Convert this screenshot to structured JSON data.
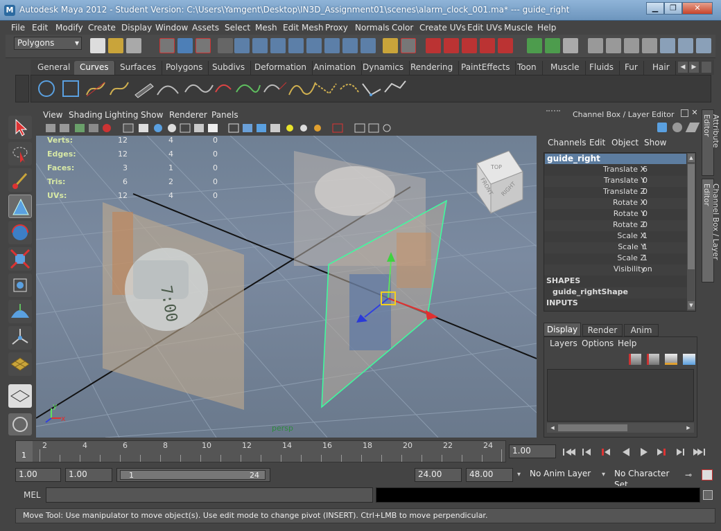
{
  "window": {
    "title": "Autodesk Maya 2012 - Student Version: C:\\Users\\Yamgent\\Desktop\\IN3D_Assignment01\\scenes\\alarm_clock_001.ma*   ---   guide_right",
    "minimize": "▁",
    "restore": "❐",
    "close": "✕"
  },
  "menubar": [
    "File",
    "Edit",
    "Modify",
    "Create",
    "Display",
    "Window",
    "Assets",
    "Select",
    "Mesh",
    "Edit Mesh",
    "Proxy",
    "Normals",
    "Color",
    "Create UVs",
    "Edit UVs",
    "Muscle",
    "Help"
  ],
  "statusline": {
    "menuset": "Polygons"
  },
  "shelf": {
    "tabs": [
      "General",
      "Curves",
      "Surfaces",
      "Polygons",
      "Subdivs",
      "Deformation",
      "Animation",
      "Dynamics",
      "Rendering",
      "PaintEffects",
      "Toon",
      "Muscle",
      "Fluids",
      "Fur",
      "Hair"
    ],
    "active_tab": "Curves"
  },
  "viewport": {
    "menu": [
      "View",
      "Shading",
      "Lighting",
      "Show",
      "Renderer",
      "Panels"
    ],
    "camera_name": "persp",
    "viewcube": {
      "top": "TOP",
      "front": "FRONT",
      "right": "RIGHT"
    },
    "axis": {
      "x": "x",
      "y": "y"
    },
    "hud": [
      {
        "label": "Verts:",
        "v1": "12",
        "v2": "4",
        "v3": "0"
      },
      {
        "label": "Edges:",
        "v1": "12",
        "v2": "4",
        "v3": "0"
      },
      {
        "label": "Faces:",
        "v1": "3",
        "v2": "1",
        "v3": "0"
      },
      {
        "label": "Tris:",
        "v1": "6",
        "v2": "2",
        "v3": "0"
      },
      {
        "label": "UVs:",
        "v1": "12",
        "v2": "4",
        "v3": "0"
      }
    ],
    "clock_text": "7:00"
  },
  "channel_box": {
    "header": "Channel Box / Layer Editor",
    "menu": [
      "Channels",
      "Edit",
      "Object",
      "Show"
    ],
    "object": "guide_right",
    "channels": [
      {
        "name": "Translate X",
        "value": "6"
      },
      {
        "name": "Translate Y",
        "value": "0"
      },
      {
        "name": "Translate Z",
        "value": "0"
      },
      {
        "name": "Rotate X",
        "value": "0"
      },
      {
        "name": "Rotate Y",
        "value": "0"
      },
      {
        "name": "Rotate Z",
        "value": "0"
      },
      {
        "name": "Scale X",
        "value": "1"
      },
      {
        "name": "Scale Y",
        "value": "1"
      },
      {
        "name": "Scale Z",
        "value": "1"
      },
      {
        "name": "Visibility",
        "value": "on"
      }
    ],
    "shapes_header": "SHAPES",
    "shape_name": "guide_rightShape",
    "inputs_header": "INPUTS"
  },
  "side_tabs": {
    "attribute_editor": "Attribute Editor",
    "channel_box": "Channel Box / Layer Editor"
  },
  "layer_editor": {
    "tabs": [
      "Display",
      "Render",
      "Anim"
    ],
    "active_tab": "Display",
    "menu": [
      "Layers",
      "Options",
      "Help"
    ]
  },
  "time_slider": {
    "ticks": [
      "2",
      "4",
      "6",
      "8",
      "10",
      "12",
      "14",
      "16",
      "18",
      "20",
      "22",
      "24"
    ],
    "current_frame": "1",
    "current_time_field": "1.00"
  },
  "range_slider": {
    "start_time": "1.00",
    "playback_start": "1.00",
    "range_start": "1",
    "range_end": "24",
    "playback_end": "24.00",
    "end_time": "48.00",
    "anim_layer": "No Anim Layer",
    "character_set": "No Character Set"
  },
  "command_line": {
    "label": "MEL"
  },
  "help_line": {
    "text": "Move Tool: Use manipulator to move object(s). Use edit mode to change pivot (INSERT).  Ctrl+LMB to move perpendicular."
  }
}
